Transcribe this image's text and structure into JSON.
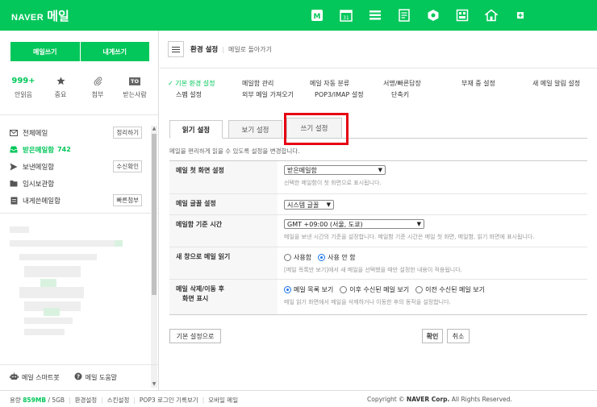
{
  "brand": {
    "naver": "NAVER",
    "mail": "메일"
  },
  "topbar": {
    "icons": [
      "mail-app-icon",
      "calendar-icon",
      "contacts-icon",
      "memo-icon",
      "cloud-icon",
      "office-icon",
      "blog-icon",
      "more-icon"
    ]
  },
  "sidebar": {
    "write_label": "메일쓰기",
    "self_write_label": "내게쓰기",
    "quick": [
      {
        "top": "999+",
        "label": "안읽음"
      },
      {
        "icon": "star-icon",
        "label": "중요"
      },
      {
        "icon": "clip-icon",
        "label": "첨부"
      },
      {
        "top": "TO",
        "label": "받는사람"
      }
    ],
    "folders": [
      {
        "name": "전체메일",
        "icon": "envelope-icon",
        "button": "정리하기"
      },
      {
        "name": "받은메일함",
        "icon": "inbox-icon",
        "count": "742",
        "active": true
      },
      {
        "name": "보낸메일함",
        "icon": "send-icon",
        "button": "수신확인"
      },
      {
        "name": "임시보관함",
        "icon": "folder-icon"
      },
      {
        "name": "내게쓴메일함",
        "icon": "note-icon",
        "button": "빠른첨부"
      }
    ],
    "footer": {
      "smartbot": "메일 스마트봇",
      "help": "메일 도움말"
    }
  },
  "main": {
    "title": "환경 설정",
    "back": "메일로 돌아가기",
    "menu_row1": [
      "✓ 기본 환경 설정",
      "메일함 관리",
      "메일 자동 분류",
      "서명/빠른답장",
      "부재 중 설정",
      "새 메일 알림 설정"
    ],
    "menu_row2": [
      "스팸 설정",
      "외부 메일 가져오기",
      "POP3/IMAP 설정",
      "단축키"
    ],
    "tabs": [
      "읽기 설정",
      "보기 설정",
      "쓰기 설정"
    ],
    "intro": "메일을 편리하게 읽을 수 있도록 설정을 변경합니다.",
    "settings": {
      "first_screen": {
        "label": "메일 첫 화면 설정",
        "value": "받은메일함",
        "desc": "선택한 메일함이 첫 화면으로 표시됩니다."
      },
      "font": {
        "label": "메일 글꼴 설정",
        "value": "시스템 글꼴"
      },
      "timezone": {
        "label": "메일함 기준 시간",
        "value": "GMT +09:00 (서울, 도쿄)",
        "desc": "메일을 보낸 시간의 기준을 설정합니다. 메일함 기준 시간은 메일 첫 화면, 메일함, 읽기 화면에 표시됩니다."
      },
      "new_window": {
        "label": "새 창으로 메일 읽기",
        "opt_use": "사용함",
        "opt_nouse": "사용 안 함",
        "desc": "[메일 목록만 보기]에서 새 메일을 선택했을 때만 설정한 내용이 적용됩니다."
      },
      "after_delete": {
        "label1": "메일 삭제/이동 후",
        "label2": "화면 표시",
        "opt1": "메일 목록 보기",
        "opt2": "이후 수신된 메일 보기",
        "opt3": "이전 수신된 메일 보기",
        "desc": "메일 읽기 화면에서 메일을 삭제하거나 이동한 후의 동작을 설정합니다."
      }
    },
    "reset_label": "기본 설정으로",
    "ok_label": "확인",
    "cancel_label": "취소"
  },
  "footer": {
    "quota_label": "용량",
    "used": "859MB",
    "total": "/ 5GB",
    "links": [
      "환경설정",
      "스킨설정",
      "POP3 로그인 기록보기",
      "모바일 메일"
    ],
    "copyright_prefix": "Copyright ©",
    "copyright_company": "NAVER Corp.",
    "copyright_suffix": "All Rights Reserved."
  },
  "colors": {
    "brand": "#03c75a",
    "highlight": "#e60012",
    "radio": "#1a73e8"
  }
}
